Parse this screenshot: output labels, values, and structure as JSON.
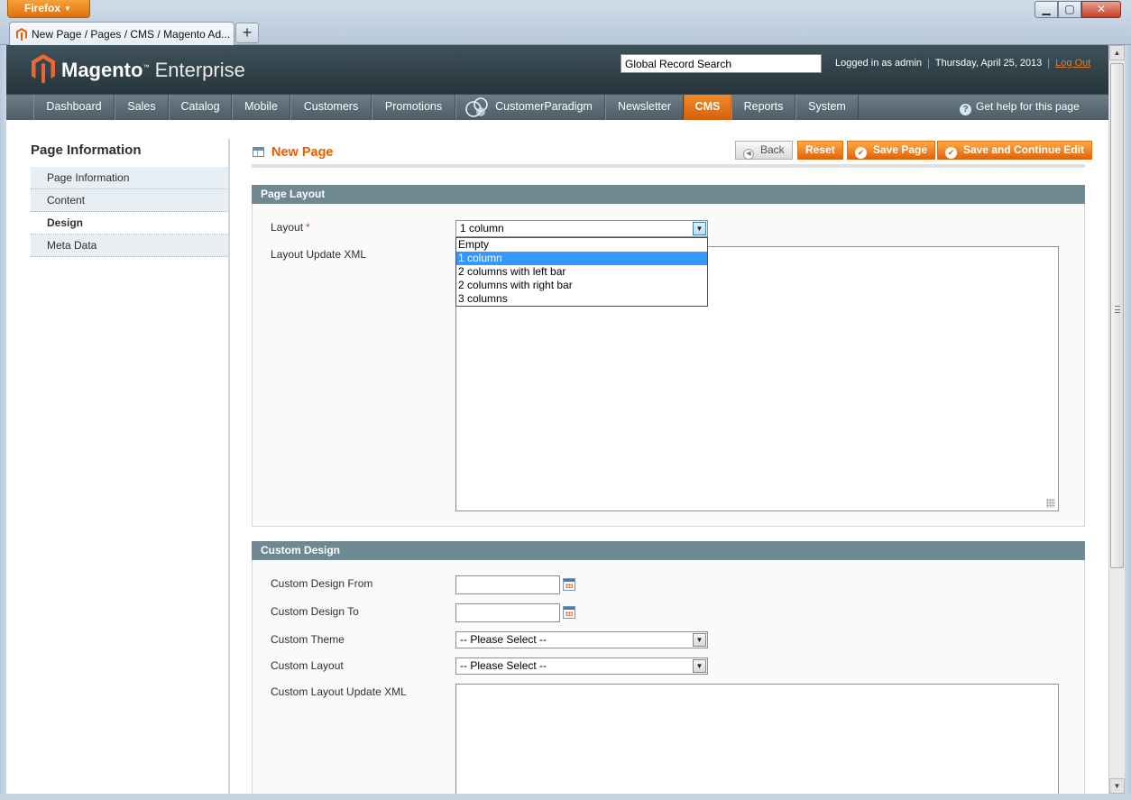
{
  "browser": {
    "menu_button": "Firefox",
    "tab_title": "New Page / Pages / CMS / Magento Ad...",
    "new_tab": "+"
  },
  "header": {
    "logo_brand": "Magento",
    "logo_edition": "Enterprise",
    "search_value": "Global Record Search",
    "logged_in": "Logged in as admin",
    "date": "Thursday, April 25, 2013",
    "logout": "Log Out"
  },
  "nav": {
    "items": [
      "Dashboard",
      "Sales",
      "Catalog",
      "Mobile",
      "Customers",
      "Promotions",
      "CustomerParadigm",
      "Newsletter",
      "CMS",
      "Reports",
      "System"
    ],
    "active": "CMS",
    "help": "Get help for this page"
  },
  "sidebar": {
    "title": "Page Information",
    "tabs": [
      "Page Information",
      "Content",
      "Design",
      "Meta Data"
    ],
    "active_tab": "Design"
  },
  "main": {
    "title": "New Page",
    "buttons": {
      "back": "Back",
      "reset": "Reset",
      "save": "Save Page",
      "save_continue": "Save and Continue Edit"
    }
  },
  "page_layout": {
    "heading": "Page Layout",
    "layout_label": "Layout",
    "layout_value": "1 column",
    "layout_options": [
      "Empty",
      "1 column",
      "2 columns with left bar",
      "2 columns with right bar",
      "3 columns"
    ],
    "layout_selected_option": "1 column",
    "xml_label": "Layout Update XML"
  },
  "custom_design": {
    "heading": "Custom Design",
    "from_label": "Custom Design From",
    "to_label": "Custom Design To",
    "theme_label": "Custom Theme",
    "theme_value": "-- Please Select --",
    "layout_label": "Custom Layout",
    "layout_value": "-- Please Select --",
    "xml_label": "Custom Layout Update XML"
  },
  "colors": {
    "accent": "#eb5e00",
    "nav_active": "#e2630a",
    "fieldset_header": "#6f8992",
    "header_bg": "#27343b"
  }
}
